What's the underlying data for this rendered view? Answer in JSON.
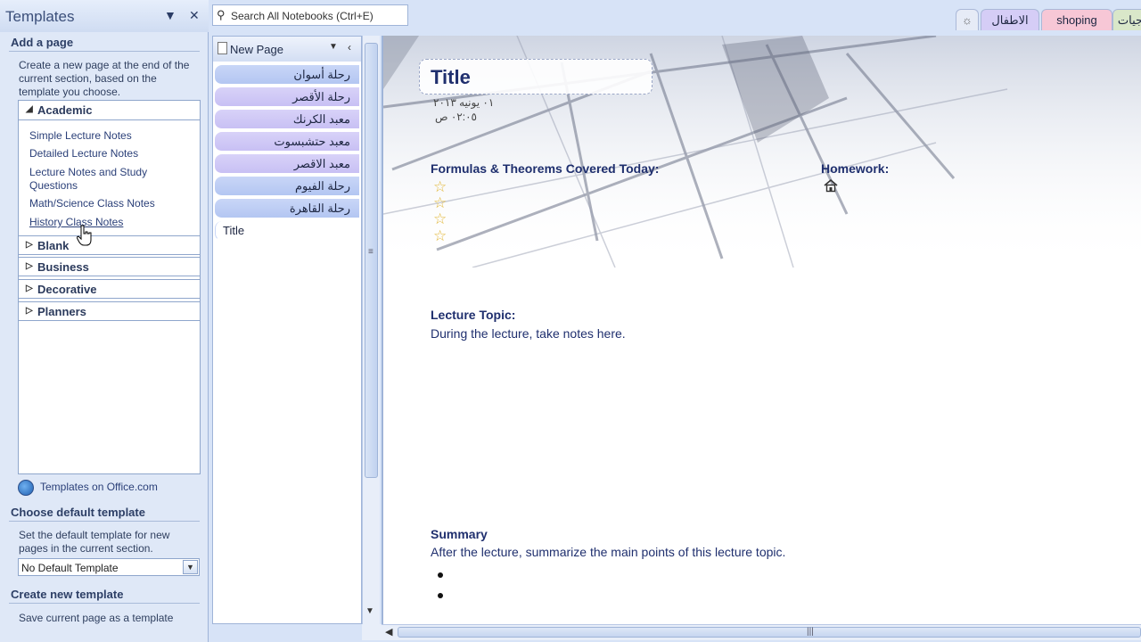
{
  "pane": {
    "title": "Templates",
    "menu_glyph": "▼",
    "close_glyph": "✕",
    "add_page": {
      "heading": "Add a page",
      "description_lines": [
        "Create a new page at the end of the",
        "current section, based on the",
        "template you choose."
      ]
    },
    "categories": [
      {
        "label": "Academic",
        "expanded": true
      },
      {
        "label": "Blank",
        "expanded": false
      },
      {
        "label": "Business",
        "expanded": false
      },
      {
        "label": "Decorative",
        "expanded": false
      },
      {
        "label": "Planners",
        "expanded": false
      }
    ],
    "academic_templates": [
      "Simple Lecture Notes",
      "Detailed Lecture Notes",
      "Lecture Notes and Study",
      "Questions",
      "Math/Science Class Notes",
      "History Class Notes"
    ],
    "office_link": "Templates on Office.com",
    "default_template": {
      "heading": "Choose default template",
      "description_lines": [
        "Set the default template for new",
        "pages in the current section."
      ],
      "selected": "No Default Template"
    },
    "create_template": {
      "heading": "Create new template",
      "link": "Save current page as a template"
    },
    "arrows": {
      "expanded": "◢",
      "collapsed": "▷"
    }
  },
  "search": {
    "placeholder": "Search All Notebooks (Ctrl+E)",
    "icon": "search-icon"
  },
  "pages": {
    "new_page_label": "New Page",
    "tabs": [
      {
        "label": "رحلة أسوان",
        "style": "blue"
      },
      {
        "label": "رحلة الأقصر",
        "style": "violet"
      },
      {
        "label": "معبد الكرنك",
        "style": "violet"
      },
      {
        "label": "معبد حتشبسوت",
        "style": "violet"
      },
      {
        "label": "معبد الاقصر",
        "style": "violet"
      },
      {
        "label": "رحلة الفيوم",
        "style": "blue"
      },
      {
        "label": "رحلة القاهرة",
        "style": "blue"
      },
      {
        "label": "Title",
        "style": "selected"
      }
    ]
  },
  "notebook_tabs": [
    {
      "label": "جيات"
    },
    {
      "label": "shoping"
    },
    {
      "label": "الاطفال"
    },
    {
      "label": "☼"
    }
  ],
  "page": {
    "title": "Title",
    "date": "٠١ يونيه ٢٠١٣",
    "time": "٠٢:٠٥ ص",
    "formulas_heading": "Formulas & Theorems Covered Today:",
    "homework_heading": "Homework:",
    "star_glyph": "☆",
    "lecture_topic_heading": "Lecture Topic:",
    "lecture_topic_text": "During the lecture, take notes here.",
    "summary_heading": "Summary",
    "summary_text": "After the lecture, summarize the main points of this lecture topic."
  },
  "colors": {
    "accent": "#1f2f6e",
    "pane_bg": "#dfe8f7",
    "tab_blue": "#b3c6f2",
    "tab_violet": "#c8c0f4",
    "tab_pink": "#f7c7d6"
  }
}
